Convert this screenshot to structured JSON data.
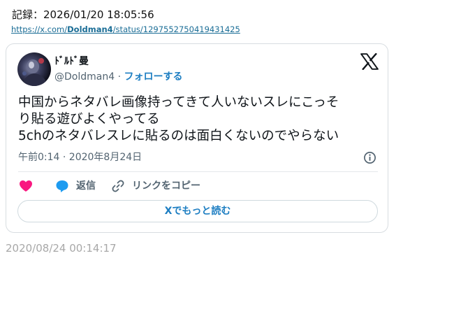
{
  "record": {
    "label": "記録：",
    "datetime": "2026/01/20 18:05:56"
  },
  "source_link": {
    "prefix": "https://x.com/",
    "user": "Doldman4",
    "suffix": "/status/1297552750419431425"
  },
  "tweet": {
    "display_name": "ﾄﾞﾙﾄﾞ曼",
    "handle": "@Doldman4",
    "separator": "·",
    "follow_label": "フォローする",
    "text_lines": [
      "中国からネタバレ画像持ってきて人いないスレにこっそ",
      "り貼る遊びよくやってる",
      "5chのネタバレスレに貼るのは面白くないのでやらない"
    ],
    "timestamp": "午前0:14 · 2020年8月24日",
    "actions": {
      "reply_label": "返信",
      "copy_link_label": "リンクをコピー"
    },
    "read_more_label": "Xでもっと読む"
  },
  "archived_at": "2020/08/24 00:14:17",
  "icons": {
    "brand": "x-logo",
    "like": "heart-icon",
    "reply": "reply-bubble-icon",
    "link": "link-icon",
    "info": "info-icon"
  },
  "colors": {
    "accent_blue": "#1d7ec2",
    "heart_pink": "#f91880",
    "reply_blue": "#1d9bf0",
    "muted_text": "#536471",
    "archived_gray": "#a8a8a8"
  }
}
